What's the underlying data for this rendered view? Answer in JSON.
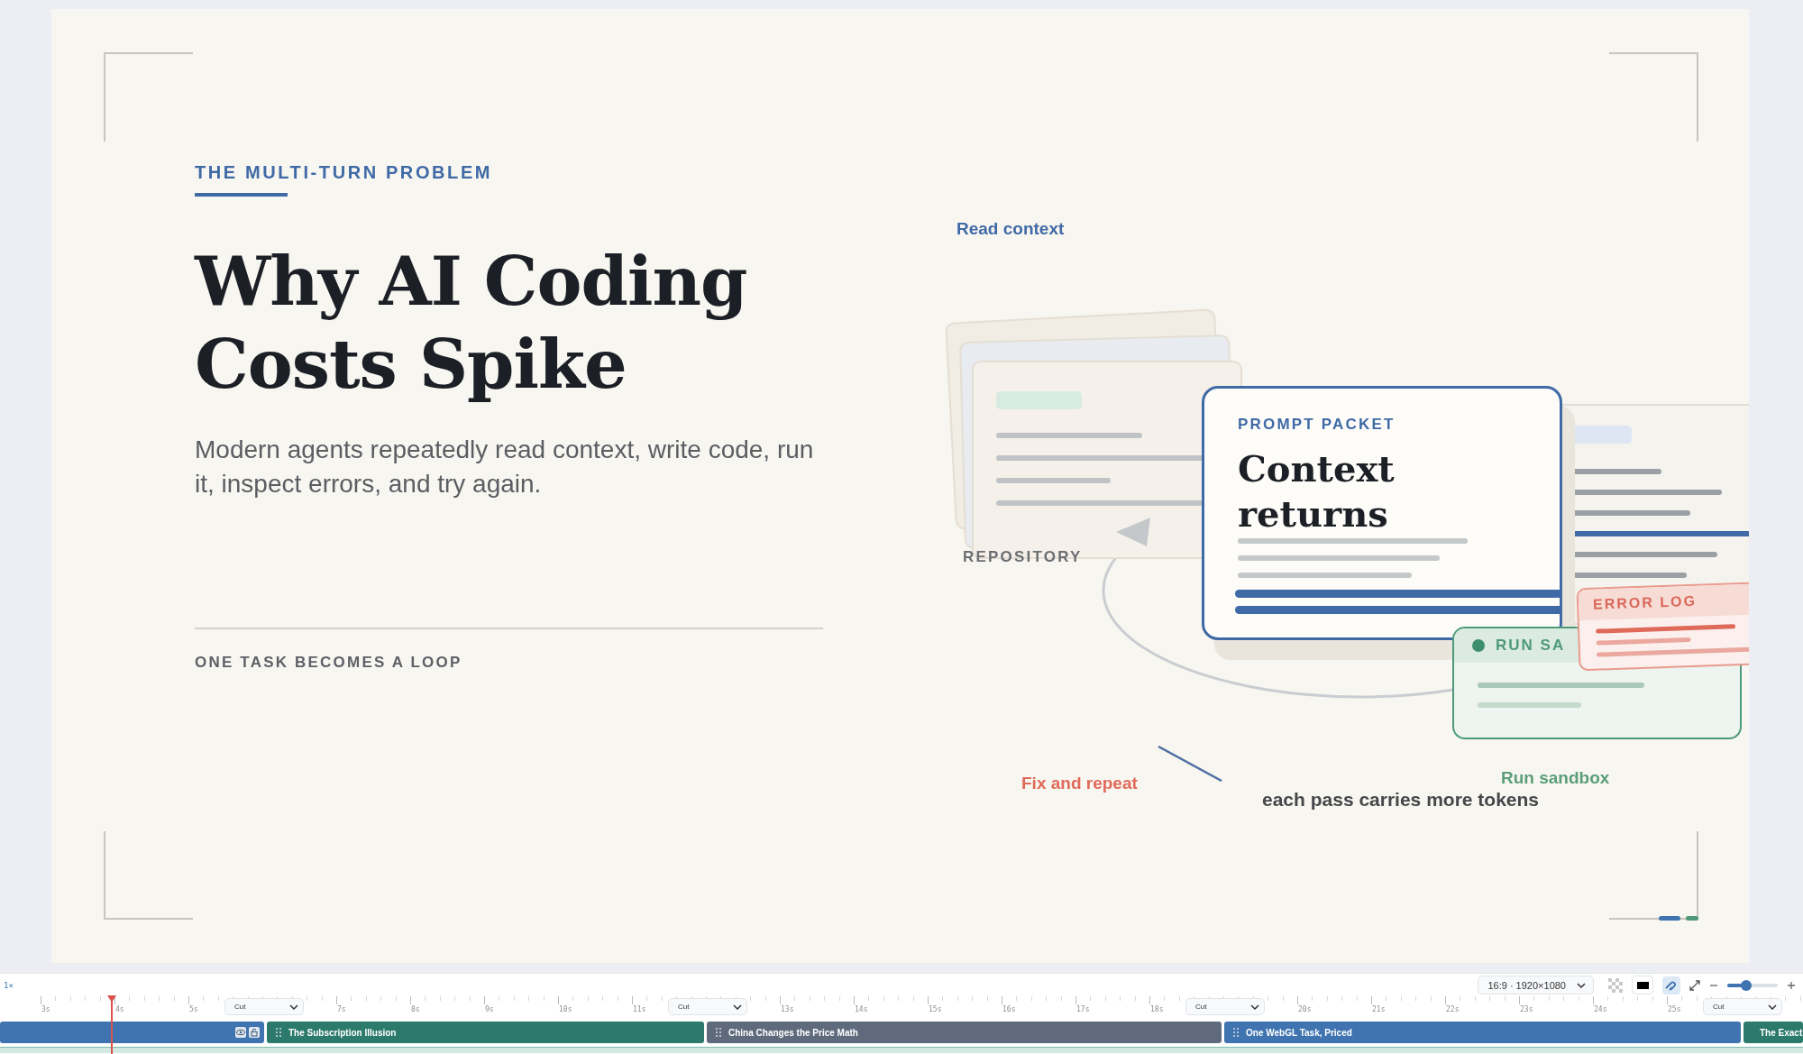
{
  "slide": {
    "kicker": "THE MULTI-TURN PROBLEM",
    "title_lines": [
      "Why AI Coding",
      "Costs Spike"
    ],
    "subtitle": "Modern agents repeatedly read context, write code, run it, inspect errors, and try again.",
    "footer_label": "ONE TASK BECOMES A LOOP",
    "illustration": {
      "read_context": "Read context",
      "repository_label": "REPOSITORY",
      "prompt_packet": {
        "label": "PROMPT PACKET",
        "title_lines": [
          "Context",
          "returns"
        ]
      },
      "error_log_label": "ERROR LOG",
      "run_sandbox_header": "RUN SA",
      "fix_label": "Fix and repeat",
      "run_label": "Run sandbox",
      "caption": "each pass carries more tokens"
    }
  },
  "toolbar": {
    "speed": "1×",
    "aspect": "16:9 · 1920×1080",
    "snap_on": true,
    "zoom_slider": {
      "level": 0.38
    }
  },
  "timeline": {
    "segments": [
      {
        "ticks": [
          "3s",
          "4s",
          "5s"
        ],
        "transition": "Cut"
      },
      {
        "ticks": [
          "7s",
          "8s",
          "9s",
          "10s",
          "11s"
        ],
        "transition": "Cut"
      },
      {
        "ticks": [
          "13s",
          "14s",
          "15s",
          "16s",
          "17s",
          "18s"
        ],
        "transition": "Cut"
      },
      {
        "ticks": [
          "20s",
          "21s",
          "22s",
          "23s",
          "24s",
          "25s"
        ],
        "transition": "Cut"
      }
    ],
    "clips": [
      {
        "color": "#3f74b0"
      },
      {
        "title": "The Subscription Illusion",
        "color": "#2c7a6c"
      },
      {
        "title": "China Changes the Price Math",
        "color": "#5f6b7c"
      },
      {
        "title": "One WebGL Task, Priced",
        "color": "#3f74b0"
      },
      {
        "title": "The Exact",
        "color": "#2c7a6c"
      }
    ]
  }
}
